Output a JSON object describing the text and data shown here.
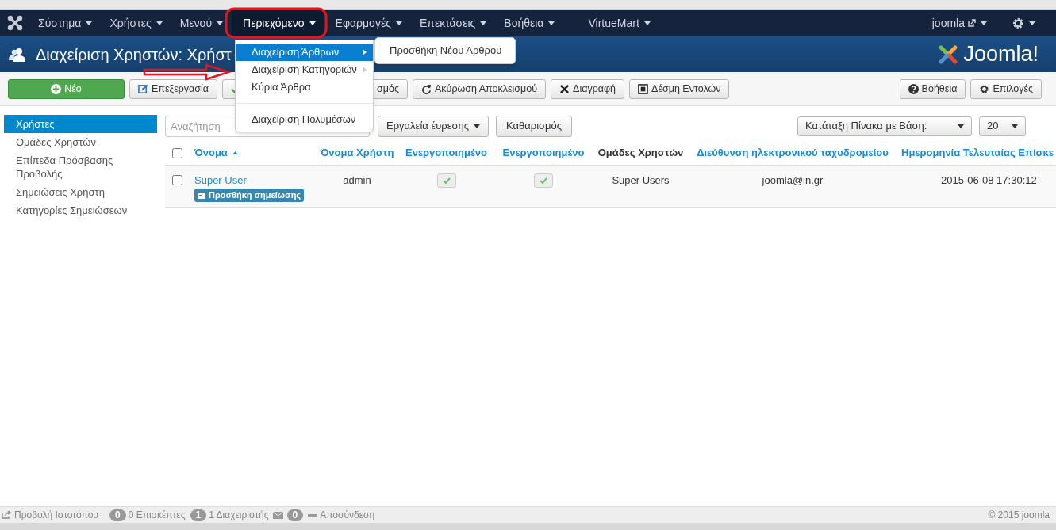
{
  "nav": {
    "items": [
      {
        "label": "Σύστημα",
        "selected": false
      },
      {
        "label": "Χρήστες",
        "selected": false
      },
      {
        "label": "Μενού",
        "selected": false
      },
      {
        "label": "Περιεχόμενο",
        "selected": true
      },
      {
        "label": "Εφαρμογές",
        "selected": false
      },
      {
        "label": "Επεκτάσεις",
        "selected": false
      },
      {
        "label": "Βοήθεια",
        "selected": false
      },
      {
        "label": "VirtueMart",
        "selected": false
      }
    ],
    "user": "joomla"
  },
  "dropdown": {
    "items": [
      {
        "kind": "item",
        "label": "Διαχείριση Άρθρων",
        "selected": true,
        "submenu": true
      },
      {
        "kind": "item",
        "label": "Διαχείριση Κατηγοριών",
        "selected": false,
        "submenu": true
      },
      {
        "kind": "item",
        "label": "Κύρια Άρθρα",
        "selected": false,
        "submenu": false
      },
      {
        "kind": "divider"
      },
      {
        "kind": "item",
        "label": "Διαχείριση Πολυμέσων",
        "selected": false,
        "submenu": false
      }
    ],
    "submenu": [
      "Προσθήκη Νέου Άρθρου"
    ]
  },
  "header": {
    "title": "Διαχείριση Χρηστών: Χρήστ",
    "logo": "Joomla!"
  },
  "toolbar": {
    "left": [
      {
        "kind": "primary",
        "label": "Νέο"
      },
      {
        "kind": "plain",
        "label": "Επεξεργασία"
      },
      {
        "kind": "covered_icon"
      },
      {
        "kind": "covered",
        "label": "σμός"
      },
      {
        "kind": "plain",
        "label": "Ακύρωση Αποκλεισμού"
      },
      {
        "kind": "plain",
        "label": "Διαγραφή"
      },
      {
        "kind": "plain",
        "label": "Δέσμη Εντολών"
      }
    ],
    "right": [
      {
        "kind": "plain",
        "label": "Βοήθεια"
      },
      {
        "kind": "plain",
        "label": "Επιλογές"
      }
    ]
  },
  "sidebar": {
    "items": [
      {
        "label": "Χρήστες",
        "selected": true
      },
      {
        "label": "Ομάδες Χρηστών",
        "selected": false
      },
      {
        "label": "Επίπεδα Πρόσβασης Προβολής",
        "selected": false
      },
      {
        "label": "Σημειώσεις Χρήστη",
        "selected": false
      },
      {
        "label": "Κατηγορίες Σημειώσεων",
        "selected": false
      }
    ]
  },
  "filters": {
    "search": {
      "placeholder": "Αναζήτηση"
    },
    "tools": "Εργαλεία έυρεσης",
    "clear": "Καθαρισμός",
    "sort": "Κατάταξη Πίνακα με Βάση:",
    "limit": "20"
  },
  "table": {
    "select_all": false,
    "columns": [
      {
        "label": "Όνομα",
        "link": true,
        "sorted": true
      },
      {
        "label": "Όνομα Χρήστη",
        "link": true,
        "sorted": false
      },
      {
        "label": "Ενεργοποιημένο",
        "link": true,
        "sorted": false
      },
      {
        "label": "Ενεργοποιημένο",
        "link": true,
        "sorted": false
      },
      {
        "label": "Ομάδες Χρηστών",
        "link": false,
        "sorted": false
      },
      {
        "label": "Διεύθυνση ηλεκτρονικού ταχυδρομείου",
        "link": true,
        "sorted": false
      },
      {
        "label": "Ημερομηνία Τελευταίας Επίσκε",
        "link": true,
        "sorted": false
      }
    ],
    "rows": [
      {
        "checked": false,
        "name": "Super User",
        "note": "Προσθήκη σημείωσης",
        "username": "admin",
        "enabled": true,
        "activated": true,
        "groups": "Super Users",
        "email": "joomla@in.gr",
        "last_visit": "2015-06-08 17:30:12"
      }
    ]
  },
  "footer": {
    "view_site": "Προβολή Ιστοτόπου",
    "visitors_count": "0",
    "visitors": "0 Επισκέπτες",
    "admins_count": "1",
    "admins": "1 Διαχειριστής",
    "messages_count": "0",
    "logout": "Αποσύνδεση",
    "copyright": "© 2015 joomla"
  }
}
